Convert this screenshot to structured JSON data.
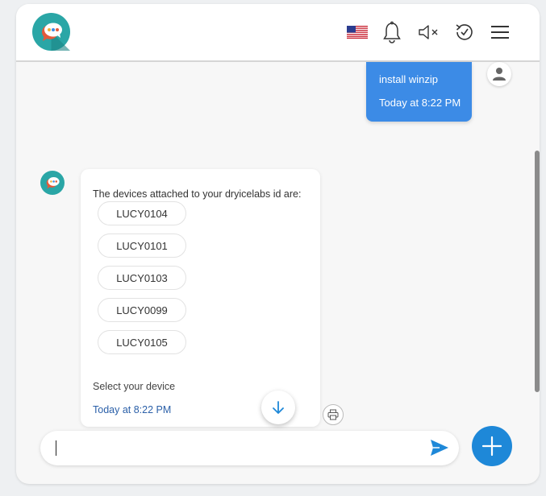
{
  "header": {
    "logo_icon": "chat-bubble-logo-icon",
    "flag_icon": "us-flag-icon",
    "notification_icon": "bell-icon",
    "mute_icon": "speaker-muted-icon",
    "history_icon": "history-icon",
    "menu_icon": "hamburger-menu-icon"
  },
  "conversation": {
    "user_message": {
      "text": "install winzip",
      "time": "Today at 8:22 PM",
      "avatar_icon": "user-icon"
    },
    "bot_message": {
      "avatar_icon": "chat-bubble-logo-icon",
      "intro": "The devices attached to your dryicelabs id are:",
      "devices": [
        "LUCY0104",
        "LUCY0101",
        "LUCY0103",
        "LUCY0099",
        "LUCY0105"
      ],
      "prompt": "Select your device",
      "time": "Today at 8:22 PM"
    },
    "scroll_down_icon": "arrow-down-icon",
    "print_icon": "printer-icon"
  },
  "composer": {
    "input_value": "",
    "input_placeholder": "",
    "send_icon": "send-icon",
    "add_icon": "plus-icon"
  },
  "colors": {
    "accent": "#1e88d8",
    "user_bubble": "#3c8be6",
    "bot_time": "#2a5fa8"
  }
}
